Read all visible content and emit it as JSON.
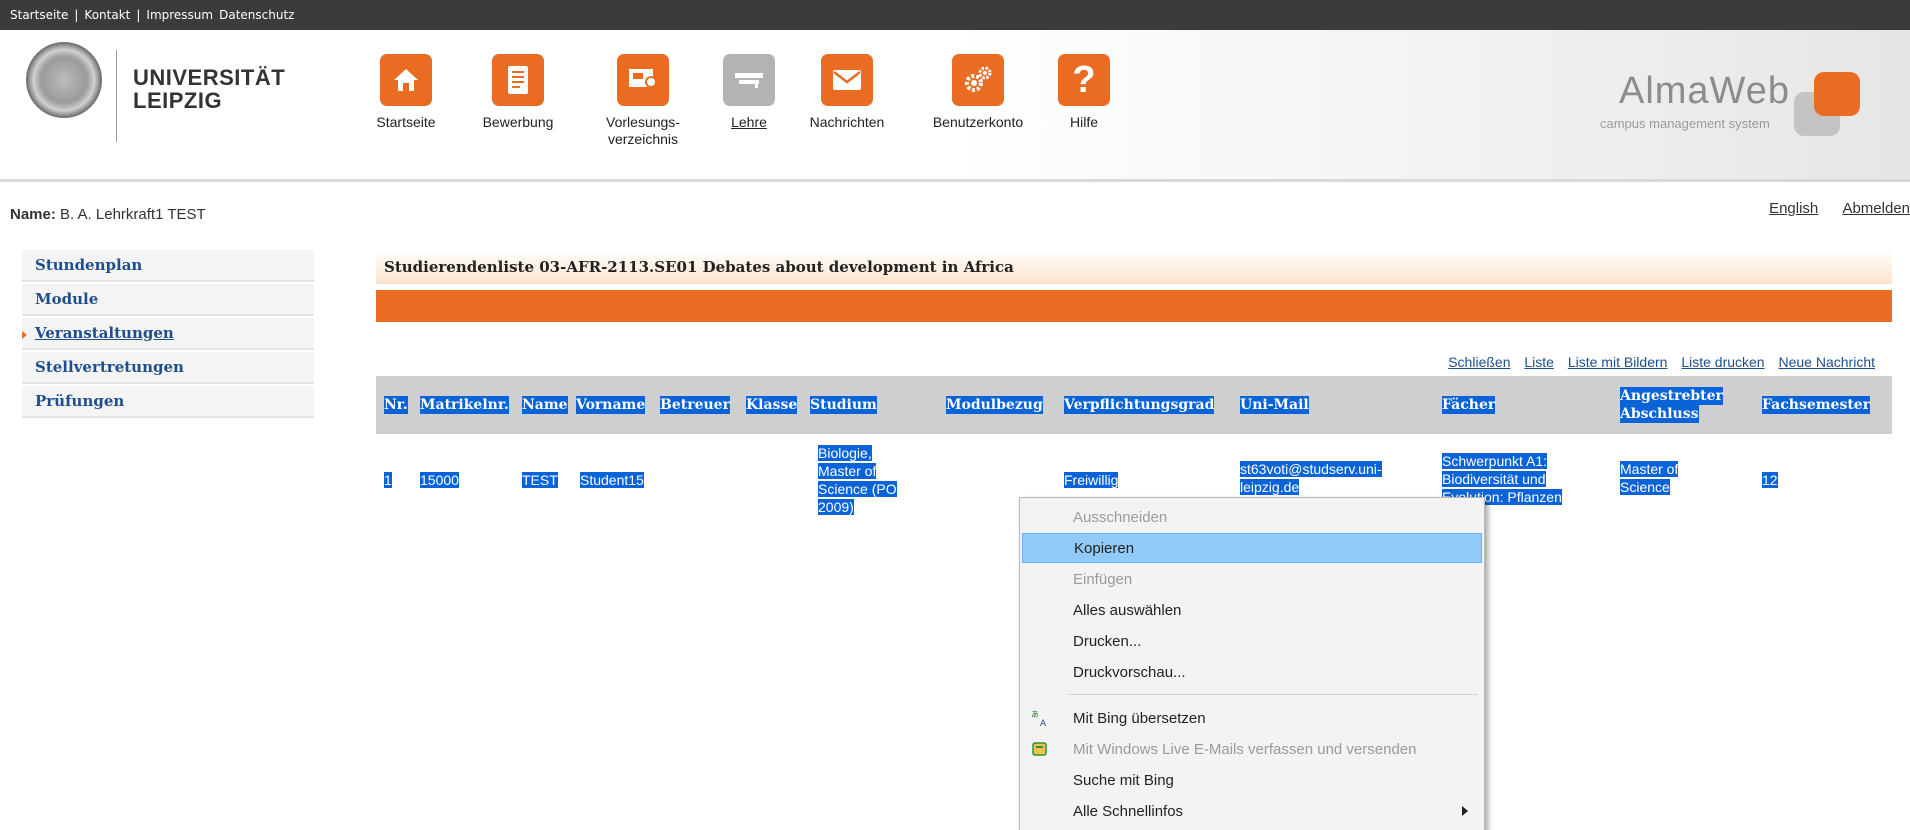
{
  "topbar": {
    "links": [
      "Startseite",
      "Kontakt",
      "Impressum",
      "Datenschutz"
    ]
  },
  "header": {
    "university_line1": "UNIVERSITÄT",
    "university_line2": "LEIPZIG",
    "nav": [
      {
        "label": "Startseite",
        "icon": "home-icon"
      },
      {
        "label": "Bewerbung",
        "icon": "document-icon"
      },
      {
        "label": "Vorlesungs-",
        "label2": "verzeichnis",
        "icon": "presentation-icon"
      },
      {
        "label": "Lehre",
        "icon": "graduation-icon",
        "active": true
      },
      {
        "label": "Nachrichten",
        "icon": "envelope-icon"
      },
      {
        "label": "Benutzerkonto",
        "icon": "gears-icon"
      },
      {
        "label": "Hilfe",
        "icon": "question-icon"
      }
    ],
    "brand": "AlmaWeb",
    "brand_sub": "campus management system"
  },
  "user": {
    "name_label": "Name:",
    "name_value": "B. A. Lehrkraft1 TEST",
    "links": [
      "English",
      "Abmelden"
    ]
  },
  "sidebar": {
    "items": [
      {
        "label": "Stundenplan"
      },
      {
        "label": "Module"
      },
      {
        "label": "Veranstaltungen",
        "active": true
      },
      {
        "label": "Stellvertretungen"
      },
      {
        "label": "Prüfungen"
      }
    ]
  },
  "main": {
    "list_title": "Studierendenliste 03-AFR-2113.SE01  Debates about development in Africa",
    "actions": [
      "Schließen",
      "Liste",
      "Liste mit Bildern",
      "Liste drucken",
      "Neue Nachricht"
    ],
    "columns": [
      "Nr.",
      "Matrikelnr.",
      "Name",
      "Vorname",
      "Betreuer",
      "Klasse",
      "Studium",
      "Modulbezug",
      "Verpflichtungsgrad",
      "Uni-Mail",
      "Fächer",
      "Angestrebter",
      "Abschluss",
      "Fachsemester"
    ],
    "row": {
      "nr": "1",
      "matrikel": "15000",
      "name": "TEST",
      "vorname": "Student15",
      "studium_1": "Biologie,",
      "studium_2": "Master of",
      "studium_3": "Science (PO",
      "studium_4": "2009)",
      "verpflichtung": "Freiwillig",
      "mail_1": "st63voti@studserv.uni-",
      "mail_2": "leipzig.de",
      "faecher_1": "Schwerpunkt A1:",
      "faecher_2": "Biodiversität und",
      "faecher_3": "Evolution: Pflanzen",
      "abschluss_1": "Master of",
      "abschluss_2": "Science",
      "fachsemester": "12"
    },
    "selection_color": "#0a64d8"
  },
  "context_menu": {
    "items": [
      {
        "label": "Ausschneiden",
        "disabled": true
      },
      {
        "label": "Kopieren",
        "highlighted": true
      },
      {
        "label": "Einfügen",
        "disabled": true
      },
      {
        "label": "Alles auswählen"
      },
      {
        "label": "Drucken..."
      },
      {
        "label": "Druckvorschau..."
      },
      {
        "label": "Mit Bing übersetzen",
        "icon": "translate-icon"
      },
      {
        "label": "Mit Windows Live E-Mails verfassen und versenden",
        "icon": "mail-icon",
        "disabled": true
      },
      {
        "label": "Suche mit Bing"
      },
      {
        "label": "Alle Schnellinfos",
        "submenu": true
      }
    ]
  },
  "colors": {
    "accent": "#ea6c22",
    "link": "#1f4e8c",
    "highlight": "#91c9f7"
  }
}
